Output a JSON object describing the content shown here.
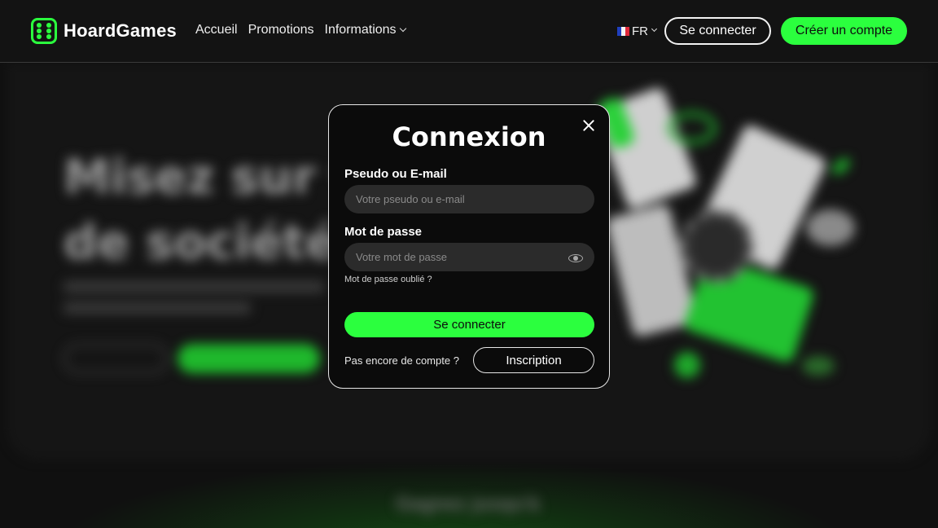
{
  "header": {
    "brand": "HoardGames",
    "nav": [
      {
        "label": "Accueil"
      },
      {
        "label": "Promotions"
      },
      {
        "label": "Informations"
      }
    ],
    "language": "FR",
    "login_label": "Se connecter",
    "register_label": "Créer un compte"
  },
  "hero": {
    "title_line1": "Misez sur vo",
    "title_line2": "de société f",
    "bottom_text": "Gagnez jusqu'à"
  },
  "modal": {
    "title": "Connexion",
    "username_label": "Pseudo ou E-mail",
    "username_placeholder": "Votre pseudo ou e-mail",
    "password_label": "Mot de passe",
    "password_placeholder": "Votre mot de passe",
    "forgot_label": "Mot de passe oublié ?",
    "submit_label": "Se connecter",
    "no_account_text": "Pas encore de compte ?",
    "signup_label": "Inscription"
  },
  "colors": {
    "accent": "#2bff3e",
    "background": "#141414",
    "modal_bg": "#0b0b0b",
    "input_bg": "#2b2b2b"
  },
  "icons": [
    "dice-logo-icon",
    "chevron-down-icon",
    "france-flag-icon",
    "close-icon",
    "eye-icon"
  ]
}
